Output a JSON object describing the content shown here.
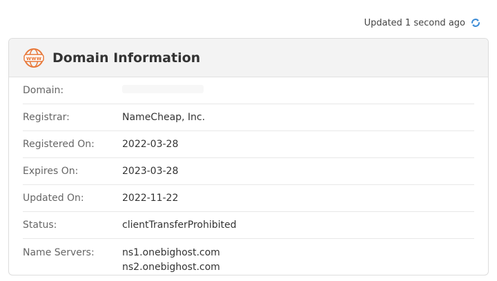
{
  "updated": {
    "text": "Updated 1 second ago"
  },
  "icons": {
    "refresh": "refresh-icon",
    "www": "www-globe-icon"
  },
  "colors": {
    "accent_blue": "#3b8bd6",
    "www_orange": "#e8793a"
  },
  "card": {
    "title": "Domain Information",
    "rows": [
      {
        "label": "Domain:",
        "value": ""
      },
      {
        "label": "Registrar:",
        "value": "NameCheap, Inc."
      },
      {
        "label": "Registered On:",
        "value": "2022-03-28"
      },
      {
        "label": "Expires On:",
        "value": "2023-03-28"
      },
      {
        "label": "Updated On:",
        "value": "2022-11-22"
      },
      {
        "label": "Status:",
        "value": "clientTransferProhibited"
      },
      {
        "label": "Name Servers:",
        "values": [
          "ns1.onebighost.com",
          "ns2.onebighost.com"
        ]
      }
    ]
  }
}
